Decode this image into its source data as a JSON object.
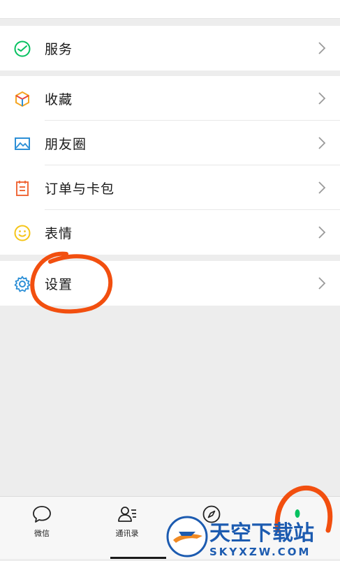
{
  "colors": {
    "accent_green": "#07c160",
    "annotation_orange": "#f24f0f",
    "icon_blue": "#2c8fd6",
    "icon_orange": "#f06b3d",
    "icon_yellow": "#f5c518"
  },
  "menu": {
    "service": {
      "label": "服务",
      "icon": "wechat-pay-icon"
    },
    "favorites": {
      "label": "收藏",
      "icon": "cube-icon"
    },
    "moments": {
      "label": "朋友圈",
      "icon": "picture-icon"
    },
    "orders_cards": {
      "label": "订单与卡包",
      "icon": "clipboard-icon"
    },
    "stickers": {
      "label": "表情",
      "icon": "smiley-icon"
    },
    "settings": {
      "label": "设置",
      "icon": "gear-icon"
    }
  },
  "tabbar": {
    "tabs": [
      {
        "label": "微信",
        "icon": "chat-bubble-icon"
      },
      {
        "label": "通讯录",
        "icon": "contacts-icon"
      },
      {
        "label": "",
        "icon": "compass-icon"
      },
      {
        "label": "",
        "icon": "me-icon"
      }
    ]
  },
  "watermark": {
    "title": "天空下载站",
    "subtitle": "SKYXZW.COM"
  }
}
